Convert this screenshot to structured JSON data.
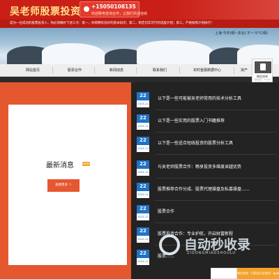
{
  "header": {
    "site_name": "吴老师股票投资理财",
    "phone": "+15050108135",
    "phone_tagline": "欢迎致电咨询合作，让我们共创佳绩",
    "ticker": "成为一位成功的股票投资人，你必须做好下述三点：第一，你得拥有良好的基本知识；第二，制定切实可行的选股计划；第三，严格按照计划执行！"
  },
  "banner": {
    "caption": "上海 今天(晴~多云) 3°~-5°C(晴)"
  },
  "nav": {
    "items": [
      "网站首页",
      "股票合作",
      "新闻动态",
      "联系我们",
      "实时金融数据中心",
      "资产"
    ]
  },
  "news": {
    "title": "最新消息",
    "badge": "NEWS",
    "more_label": "查看更多 ＞"
  },
  "list": [
    {
      "day": "22",
      "ym": "2024-12",
      "title": "以下是一些可能被吴老师常用的技术分析工具"
    },
    {
      "day": "22",
      "ym": "2024-12",
      "title": "以下是一些实用的股票入门书籍推荐"
    },
    {
      "day": "22",
      "ym": "2024-12",
      "title": "以下是一些适合短线投资的股票分析工具"
    },
    {
      "day": "22",
      "ym": "2024-12",
      "title": "与吴老师股票合作：畅享投资多维度卓越优势"
    },
    {
      "day": "22",
      "ym": "2024-12",
      "title": "股票推荐合作分成、股票代理操盘及私募操盘……"
    },
    {
      "day": "22",
      "ym": "2024-12",
      "title": "股票合作"
    },
    {
      "day": "22",
      "ym": "2024-12",
      "title": "股票投资合作：专业护航，开启财富新程"
    },
    {
      "day": "22",
      "ym": "2024-12",
      "title": "股票……"
    }
  ],
  "qr": {
    "label": "微信咨询",
    "sub": "扫描关注 · 24小时"
  },
  "watermark": {
    "main": "自动秒收录",
    "sub": "ZIDONGMIAOSHOULU"
  },
  "cta": {
    "label": "微信咨询 · 扫码关注吴老师 · gupiao"
  },
  "colors": {
    "brand_red": "#c91f16",
    "accent_orange": "#e5572f",
    "date_blue": "#1f73c7",
    "cta_amber": "#f4a22a"
  }
}
